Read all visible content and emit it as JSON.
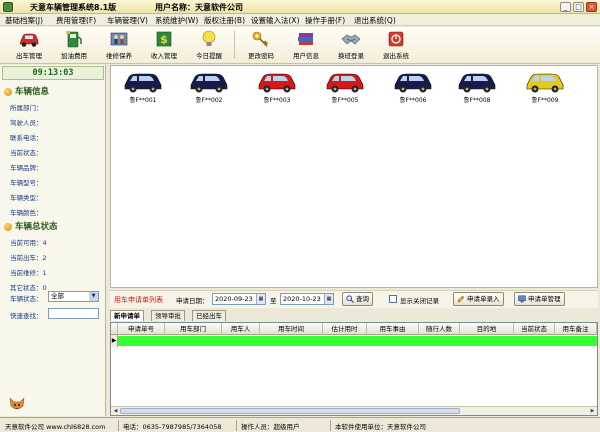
{
  "window": {
    "title": "天意车辆管理系统8.1版",
    "user_label": "用户名称：天意软件公司"
  },
  "menu": [
    "基础档案(J)",
    "费用管理(F)",
    "车辆管理(V)",
    "系统维护(W)",
    "版权注册(B)",
    "设置输入法(X)",
    "操作手册(F)",
    "退出系统(Q)"
  ],
  "toolbar": [
    {
      "label": "出车管理",
      "icon": "car-icon",
      "color": "#d42b2b"
    },
    {
      "label": "加油费用",
      "icon": "fuel-icon",
      "color": "#2c8a3a"
    },
    {
      "label": "维修保养",
      "icon": "repair-icon",
      "color": "#446699"
    },
    {
      "label": "收入管理",
      "icon": "money-icon",
      "color": "#c8a020"
    },
    {
      "label": "今日提醒",
      "icon": "lightbulb-icon",
      "color": "#f0d020"
    },
    {
      "label": "更改密码",
      "icon": "key-icon",
      "color": "#d4a020"
    },
    {
      "label": "用户信息",
      "icon": "books-icon",
      "color": "#8a3a9a"
    },
    {
      "label": "换班登录",
      "icon": "handshake-icon",
      "color": "#6a7a8a"
    },
    {
      "label": "退出系统",
      "icon": "power-icon",
      "color": "#d43a2a"
    }
  ],
  "clock": "09:13:03",
  "vehicle_info": {
    "title": "车辆信息",
    "fields": [
      "所属部门：",
      "驾驶人员：",
      "联系电话：",
      "当前状态：",
      "车辆品牌：",
      "车辆型号：",
      "车辆类型：",
      "车辆颜色："
    ]
  },
  "vehicle_status": {
    "title": "车辆总状态",
    "items": [
      {
        "label": "当前可用：",
        "value": "4"
      },
      {
        "label": "当前出车：",
        "value": "2"
      },
      {
        "label": "当前维修：",
        "value": "1"
      },
      {
        "label": "其它状态：",
        "value": "0"
      }
    ]
  },
  "controls": {
    "status_label": "车辆状态：",
    "status_value": "全部",
    "quick_search_label": "快速查找："
  },
  "cars": [
    {
      "plate": "鲁F**001",
      "color": "#1a1a4a"
    },
    {
      "plate": "鲁F**002",
      "color": "#1a1a4a"
    },
    {
      "plate": "鲁F**003",
      "color": "#d41818"
    },
    {
      "plate": "鲁F**005",
      "color": "#d41818"
    },
    {
      "plate": "鲁F**006",
      "color": "#1a1a4a"
    },
    {
      "plate": "鲁F**008",
      "color": "#1a1a4a"
    },
    {
      "plate": "鲁F**009",
      "color": "#e8c818"
    }
  ],
  "request_bar": {
    "title": "用车申请单列表",
    "date_label": "申请日期：",
    "date_from": "2020-09-23",
    "to_label": "至",
    "date_to": "2020-10-23",
    "query_button": "查询",
    "show_closed_label": "显示关闭记录",
    "entry_button": "申请单录入",
    "manage_button": "申请单管理"
  },
  "tabs": [
    "新申请单",
    "领导审批",
    "已经出车"
  ],
  "grid": {
    "columns": [
      "申请单号",
      "用车部门",
      "用车人",
      "用车时间",
      "估计用时",
      "用车事由",
      "随行人数",
      "目的地",
      "当前状态",
      "用车备注"
    ],
    "row_indicator": "▶",
    "row_fill": "#33ff33"
  },
  "statusbar": {
    "company": "天意软件公司 www.chl6828.com",
    "phone": "电话：0635-7987985/7364058",
    "operator": "操作人员：超级用户",
    "unit": "本软件使用单位：天意软件公司"
  }
}
